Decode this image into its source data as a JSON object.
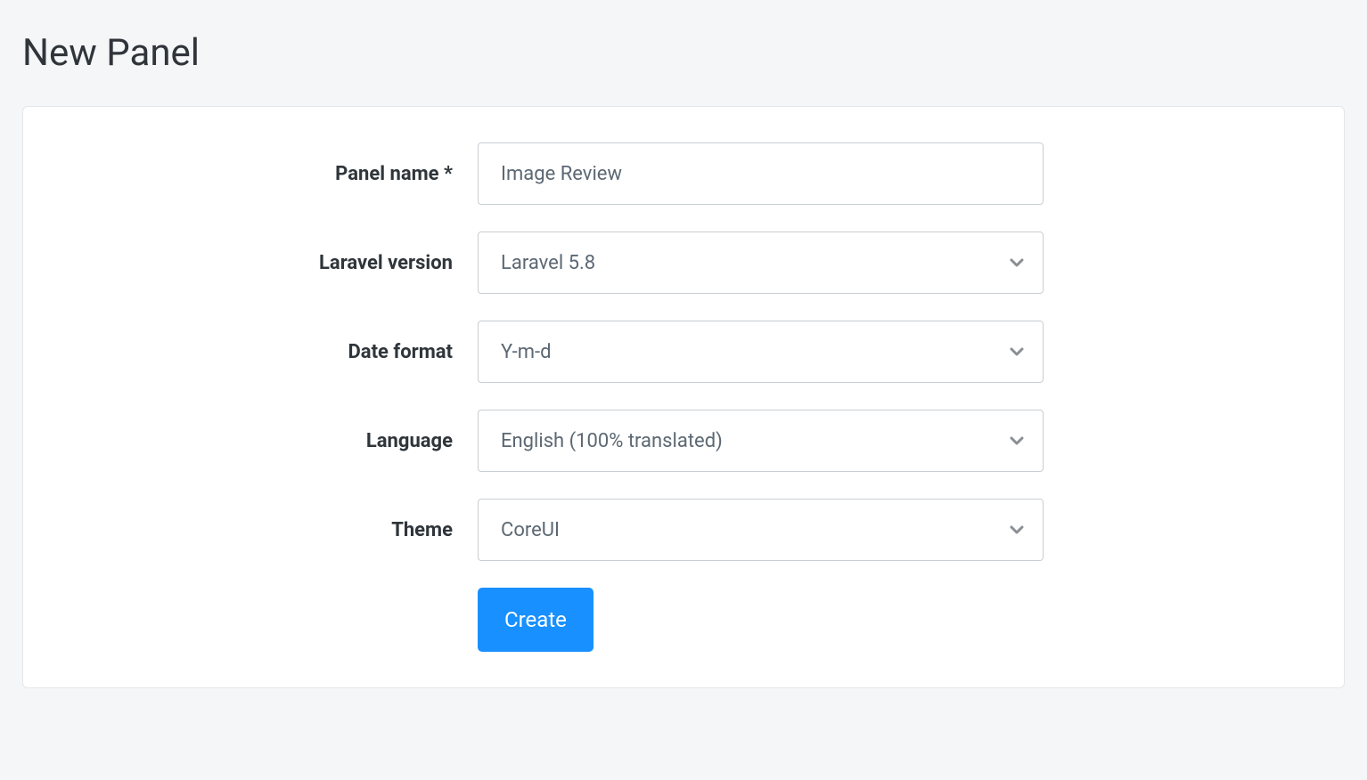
{
  "page": {
    "title": "New Panel"
  },
  "form": {
    "panel_name": {
      "label": "Panel name *",
      "value": "Image Review"
    },
    "laravel_version": {
      "label": "Laravel version",
      "value": "Laravel 5.8"
    },
    "date_format": {
      "label": "Date format",
      "value": "Y-m-d"
    },
    "language": {
      "label": "Language",
      "value": "English (100% translated)"
    },
    "theme": {
      "label": "Theme",
      "value": "CoreUI"
    },
    "submit_label": "Create"
  }
}
